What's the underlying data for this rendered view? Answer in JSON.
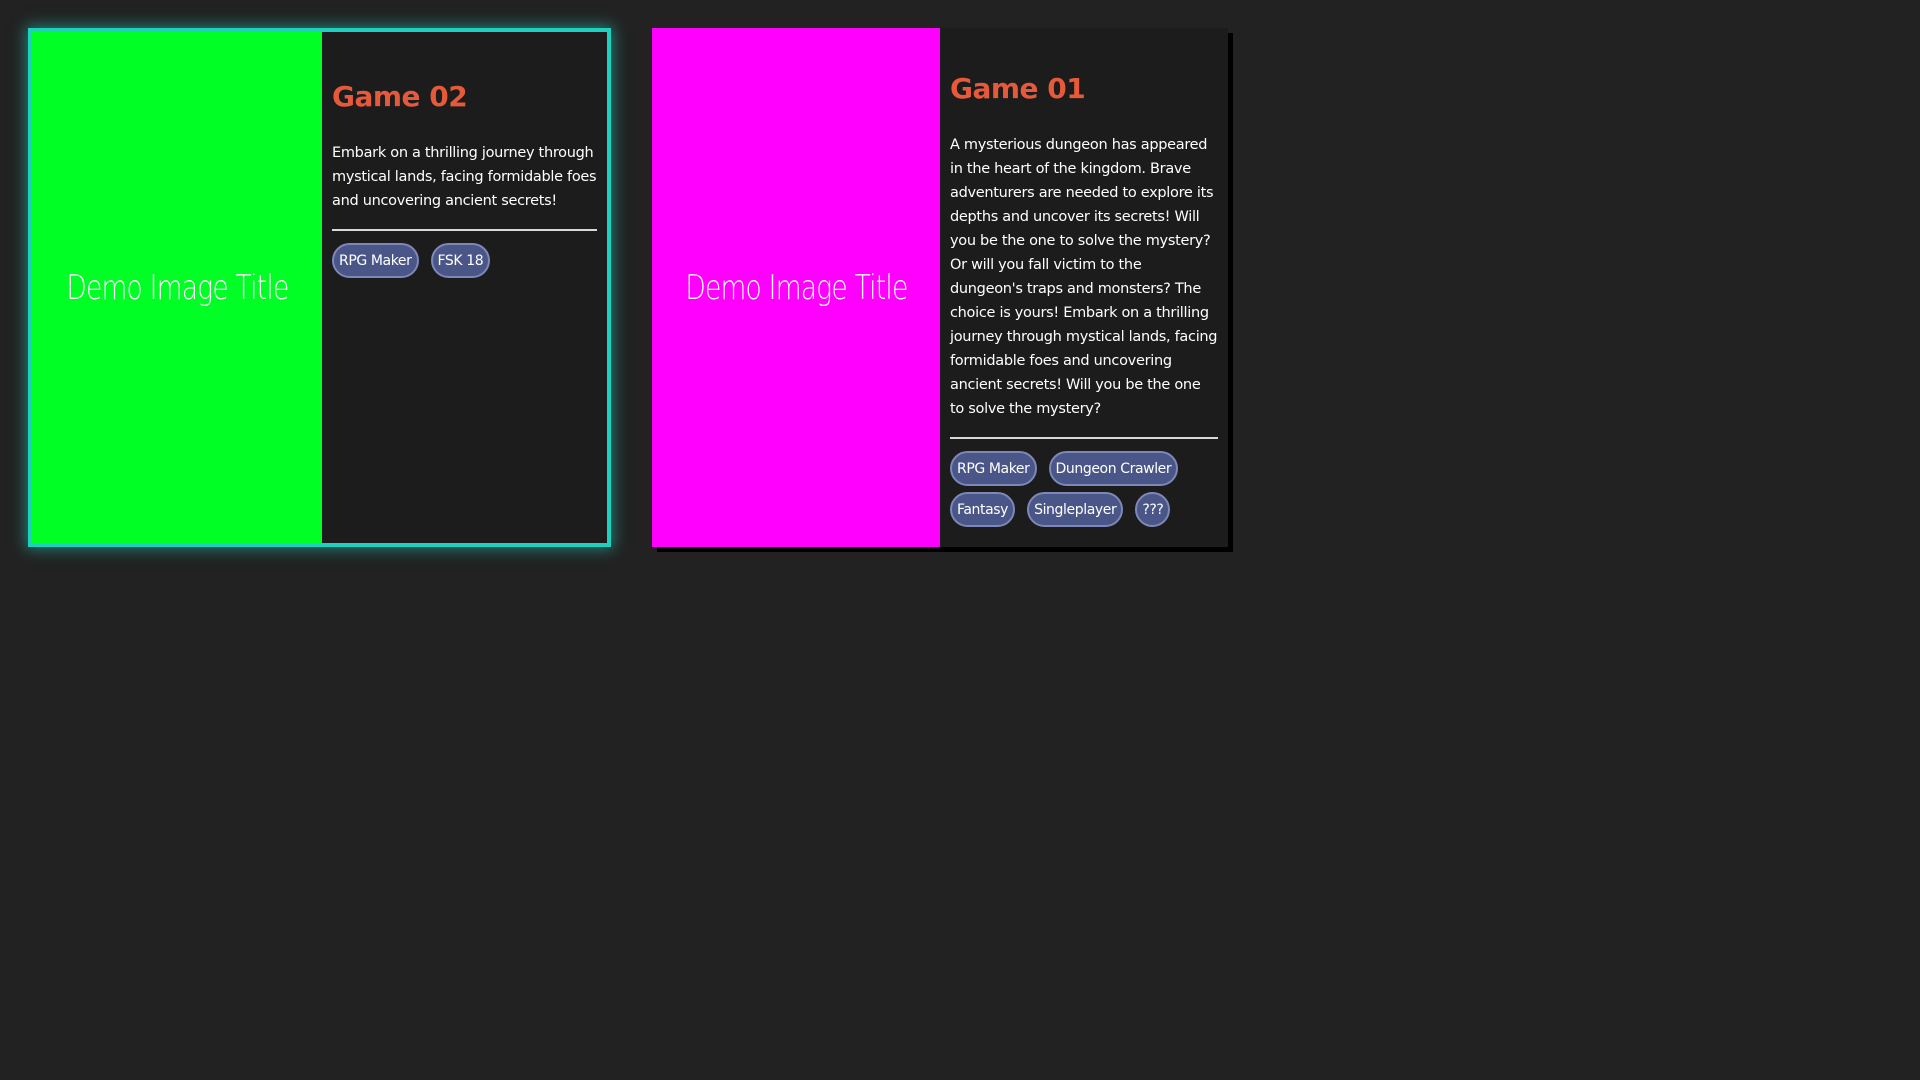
{
  "cards": [
    {
      "thumb_color": "#00ff24",
      "thumb_title": "Demo Image Title",
      "title": "Game 02",
      "description": "Embark on a thrilling journey through mystical lands, facing formidable foes and uncovering ancient secrets!",
      "tags": [
        "RPG Maker",
        "FSK 18"
      ],
      "state": "highlighted",
      "highlight_color": "#1fcfc0"
    },
    {
      "thumb_color": "#ff00ff",
      "thumb_title": "Demo Image Title",
      "title": "Game 01",
      "description": "A mysterious dungeon has appeared in the heart of the kingdom. Brave adventurers are needed to explore its depths and uncover its secrets! Will you be the one to solve the mystery? Or will you fall victim to the dungeon's traps and monsters? The choice is yours! Embark on a thrilling journey through mystical lands, facing formidable foes and uncovering ancient secrets! Will you be the one to solve the mystery?",
      "tags": [
        "RPG Maker",
        "Dungeon Crawler",
        "Fantasy",
        "Singleplayer",
        "???"
      ]
    }
  ],
  "colors": {
    "background": "#222222",
    "card_background": "#1c1c1c",
    "title": "#e65a3b",
    "tag_fill": "#4a5687",
    "tag_border": "#7d88b8"
  }
}
